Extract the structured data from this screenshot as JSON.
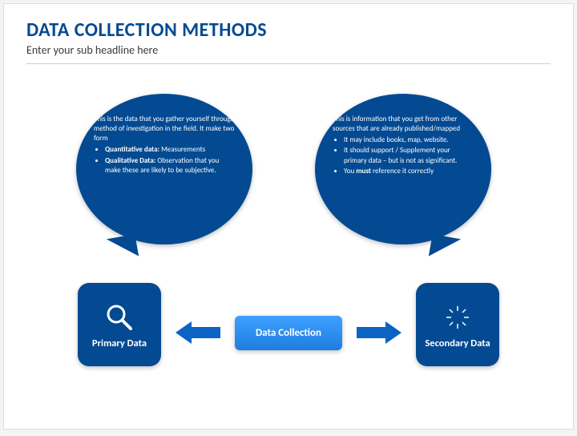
{
  "title": "DATA COLLECTION METHODS",
  "subtitle": "Enter your sub headline here",
  "colors": {
    "brand": "#034a92",
    "accent": "#1f7de0"
  },
  "bubbles": {
    "primary": {
      "intro": "This is the data that you gather yourself through method of investigation in the field. It make two form",
      "items": [
        {
          "label": "Quantitative data:",
          "desc": "Measurements"
        },
        {
          "label": "Qualitative Data:",
          "desc": "Observation that you make these are likely to be subjective."
        }
      ]
    },
    "secondary": {
      "intro": "This is information that you get from other sources that are already published/mapped",
      "items": [
        "It may include books, map, website.",
        "It should support / Supplement your primary data – but is not as significant.",
        "You must reference it correctly"
      ],
      "must_word": "must"
    }
  },
  "flow": {
    "left_node": "Primary Data",
    "center": "Data Collection",
    "right_node": "Secondary Data",
    "left_icon": "magnifier-icon",
    "right_icon": "burst-icon"
  }
}
